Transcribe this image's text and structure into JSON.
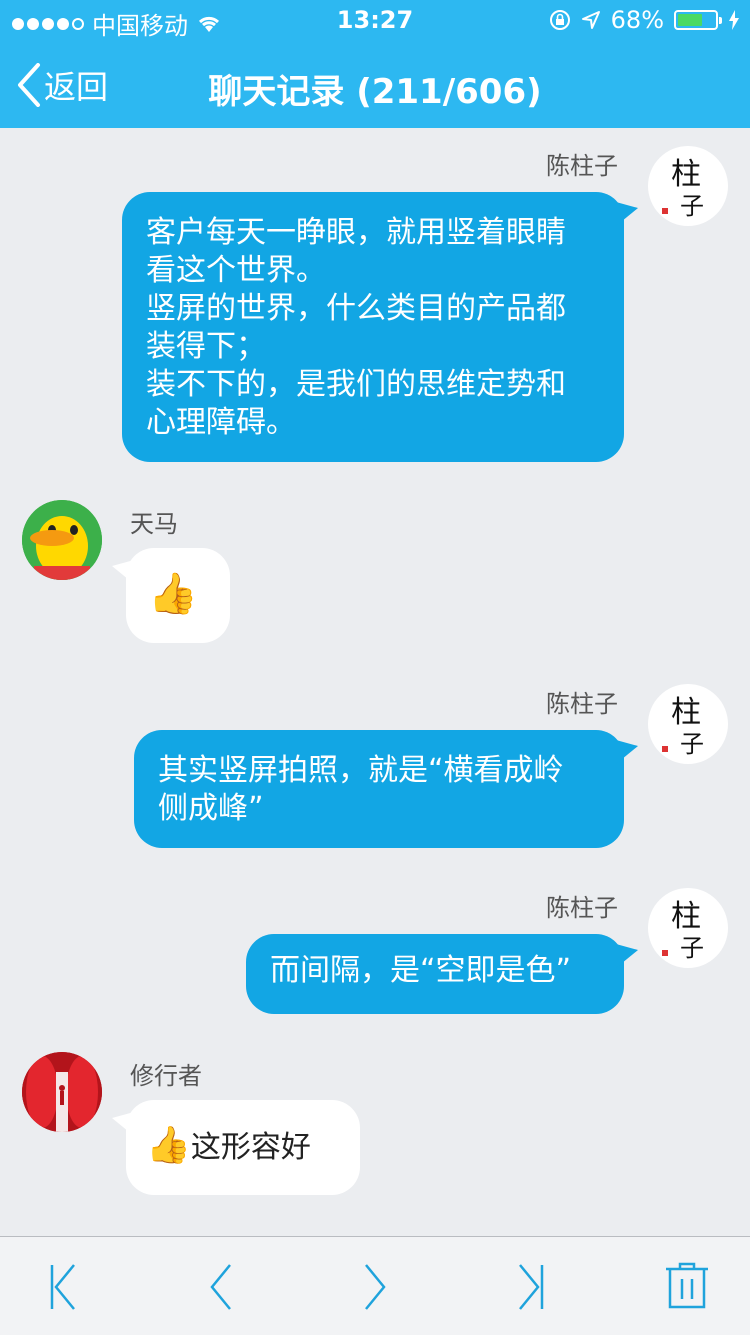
{
  "status_bar": {
    "carrier": "中国移动",
    "time": "13:27",
    "battery": "68%",
    "battery_level": 0.68
  },
  "nav": {
    "back_label": "返回",
    "title": "聊天记录 (211/606)"
  },
  "messages": [
    {
      "sender": "陈柱子",
      "lines": [
        "客户每天一睁眼，就用竖着眼睛",
        "看这个世界。",
        "竖屏的世界，什么类目的产品都",
        "装得下；",
        "装不下的，是我们的思维定势和",
        "心理障碍。"
      ]
    },
    {
      "sender": "天马",
      "emoji": "👍"
    },
    {
      "sender": "陈柱子",
      "lines": [
        "其实竖屏拍照，就是“横看成岭",
        "侧成峰”"
      ]
    },
    {
      "sender": "陈柱子",
      "lines": [
        "而间隔，是“空即是色”"
      ]
    },
    {
      "sender": "修行者",
      "emoji": "👍",
      "text": "这形容好"
    }
  ],
  "avatars": {
    "chenzhuzi_glyph": "柱",
    "chenzhuzi_glyph2": "子"
  },
  "colors": {
    "header": "#2db8f1",
    "bubble_out": "#12a6e4",
    "toolbar_icon": "#1fa3dc"
  }
}
